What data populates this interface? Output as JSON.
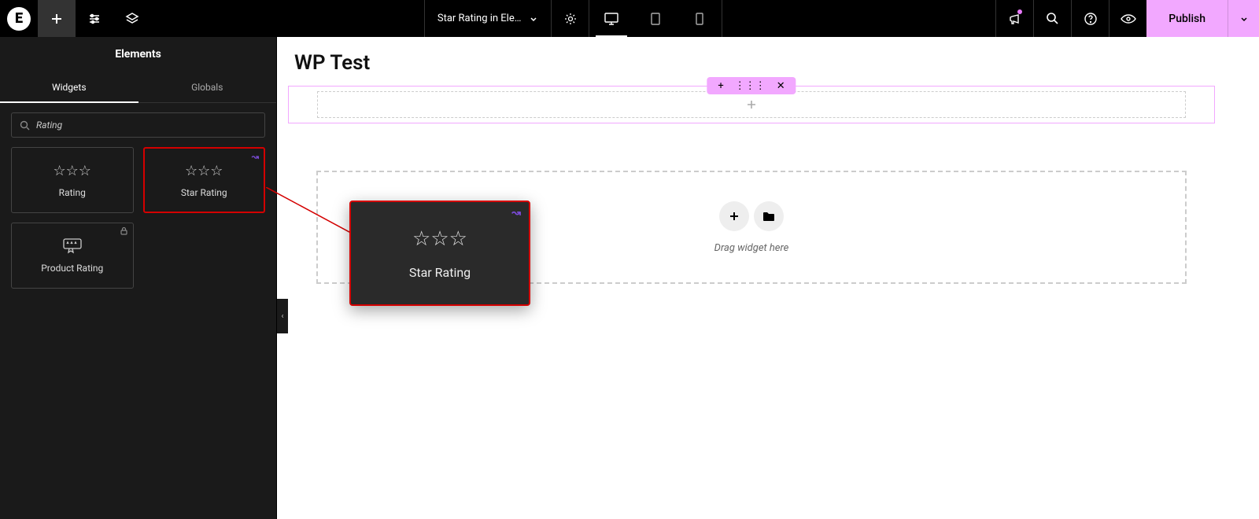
{
  "topbar": {
    "document_title": "Star Rating in Ele…",
    "publish_label": "Publish"
  },
  "sidebar": {
    "panel_title": "Elements",
    "tabs": {
      "widgets": "Widgets",
      "globals": "Globals"
    },
    "search_value": "Rating",
    "widgets": [
      {
        "label": "Rating"
      },
      {
        "label": "Star Rating"
      },
      {
        "label": "Product Rating"
      }
    ]
  },
  "canvas": {
    "page_heading": "WP Test",
    "drop_hint": "Drag widget here"
  },
  "drag_preview": {
    "label": "Star Rating"
  }
}
